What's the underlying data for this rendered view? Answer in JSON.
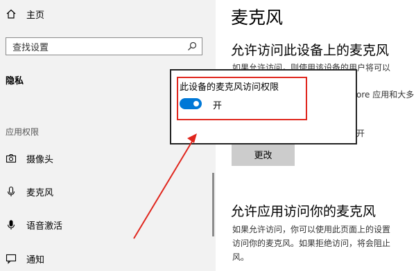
{
  "sidebar": {
    "home_label": "主页",
    "search_placeholder": "查找设置",
    "category": "隐私",
    "group_header": "应用权限",
    "items": [
      {
        "label": "摄像头"
      },
      {
        "label": "麦克风"
      },
      {
        "label": "语音激活"
      },
      {
        "label": "通知"
      }
    ]
  },
  "main": {
    "page_title": "麦克风",
    "section1_heading": "允许访问此设备上的麦克风",
    "section1_text_line1": "如果允许访问，则使用该设备的用户将可以",
    "section1_text_frag": "ore 应用和大多",
    "toggle_state_fragment": "开",
    "change_button": "更改",
    "section2_heading": "允许应用访问你的麦克风",
    "section2_text": [
      "如果允许访问，你可以使用此页面上的设置",
      "访问你的麦克风。如果拒绝访问，将会阻止",
      "风。"
    ]
  },
  "popup": {
    "title": "此设备的麦克风访问权限",
    "toggle_label": "开",
    "toggle_on": true
  },
  "colors": {
    "accent": "#0078d7",
    "highlight": "#e0261d",
    "sidebar_bg": "#f2f2f2"
  }
}
